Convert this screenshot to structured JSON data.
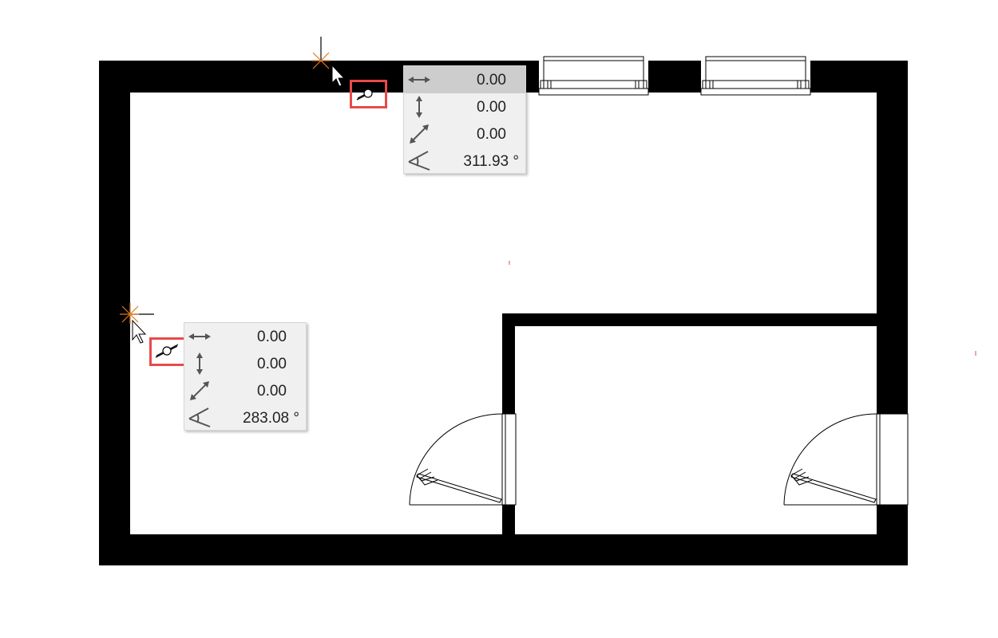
{
  "colors": {
    "wall": "#000000",
    "highlight": "#e84a4a",
    "cursor_cross": "#e07a1e",
    "tracker_bg": "#f0f0f0",
    "tracker_selected": "#cdcdcd"
  },
  "trackers": [
    {
      "x_value": "0.00",
      "y_value": "0.00",
      "distance_value": "0.00",
      "angle_value": "311.93 °",
      "selected_field": "x"
    },
    {
      "x_value": "0.00",
      "y_value": "0.00",
      "distance_value": "0.00",
      "angle_value": "283.08 °",
      "selected_field": "none"
    }
  ],
  "icons": {
    "x_field": "horizontal-arrow-icon",
    "y_field": "vertical-arrow-icon",
    "distance_field": "diagonal-arrow-icon",
    "angle_field": "angle-icon",
    "snap": "snap-midpoint-icon",
    "cursor": "pointer-cursor-icon"
  }
}
